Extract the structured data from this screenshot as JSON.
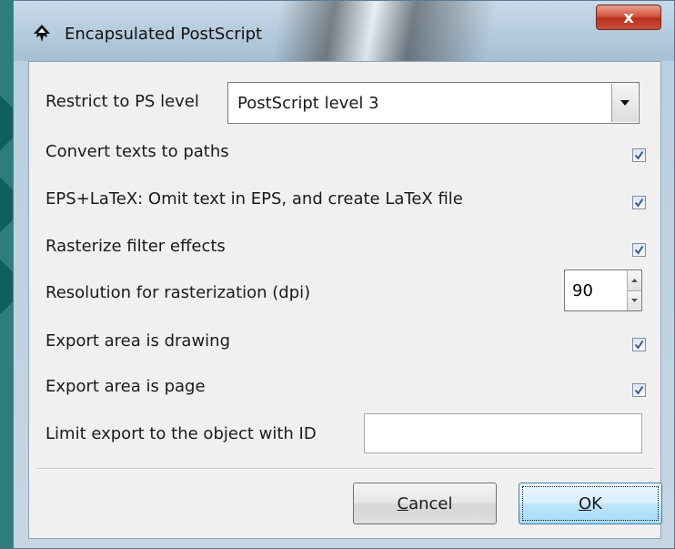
{
  "window": {
    "title": "Encapsulated PostScript",
    "close_label": "x"
  },
  "options": {
    "ps_level_label": "Restrict to PS level",
    "ps_level_value": "PostScript level 3",
    "convert_texts_label": "Convert texts to paths",
    "convert_texts_checked": true,
    "eps_latex_label": "EPS+LaTeX: Omit text in EPS, and create LaTeX file",
    "eps_latex_checked": true,
    "rasterize_label": "Rasterize filter effects",
    "rasterize_checked": true,
    "resolution_label": "Resolution for rasterization (dpi)",
    "resolution_value": "90",
    "area_drawing_label": "Export area is drawing",
    "area_drawing_checked": true,
    "area_page_label": "Export area is page",
    "area_page_checked": true,
    "limit_id_label": "Limit export to the object with ID",
    "limit_id_value": ""
  },
  "buttons": {
    "cancel_mnemonic": "C",
    "cancel_rest": "ancel",
    "ok_mnemonic": "O",
    "ok_rest": "K"
  },
  "icons": {
    "app": "inkscape-logo-icon",
    "checkbox": "checkmark-icon",
    "dropdown": "chevron-down-icon",
    "spin_up": "chevron-up-icon",
    "spin_down": "chevron-down-icon"
  },
  "colors": {
    "close_button": "#c9503b",
    "default_button_border": "#3c7fb1",
    "checkmark": "#3a5a8c"
  }
}
